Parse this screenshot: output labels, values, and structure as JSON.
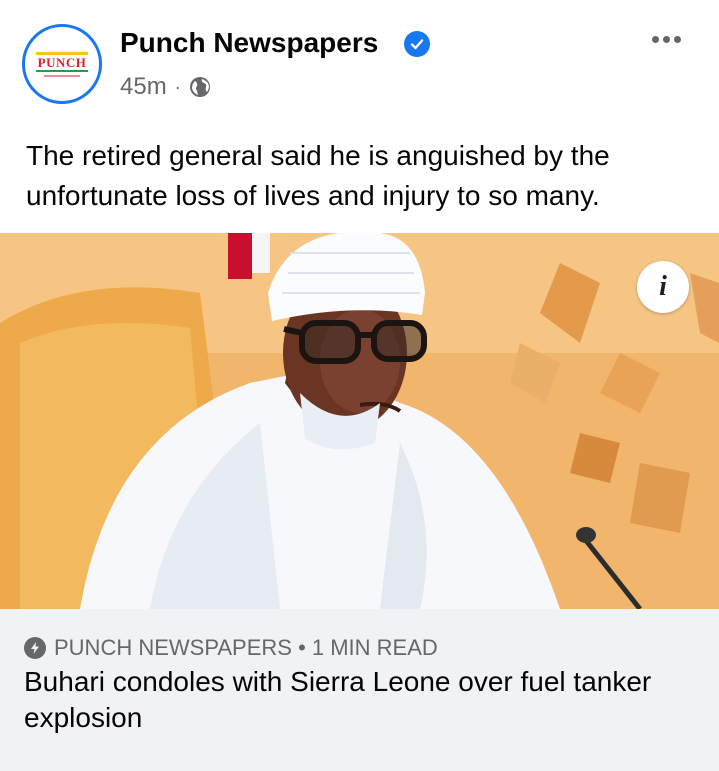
{
  "header": {
    "avatar_text": "PUNCH",
    "page_name": "Punch Newspapers",
    "verified_icon": "verified-badge-icon",
    "time": "45m",
    "separator": "·",
    "audience_icon": "globe-icon",
    "more_icon": "more-options-icon"
  },
  "post": {
    "text": "The retired general said he is anguished by the unfortunate loss of lives and injury to so many."
  },
  "photo": {
    "info_icon": "info-icon",
    "info_label": "i"
  },
  "link": {
    "source_icon": "instant-article-bolt-icon",
    "source": "PUNCH NEWSPAPERS • 1 MIN READ",
    "headline": "Buhari condoles with Sierra Leone over fuel tanker explosion"
  },
  "colors": {
    "accent": "#1877f2",
    "secondary_text": "#65676b",
    "link_background": "#f0f2f5"
  }
}
